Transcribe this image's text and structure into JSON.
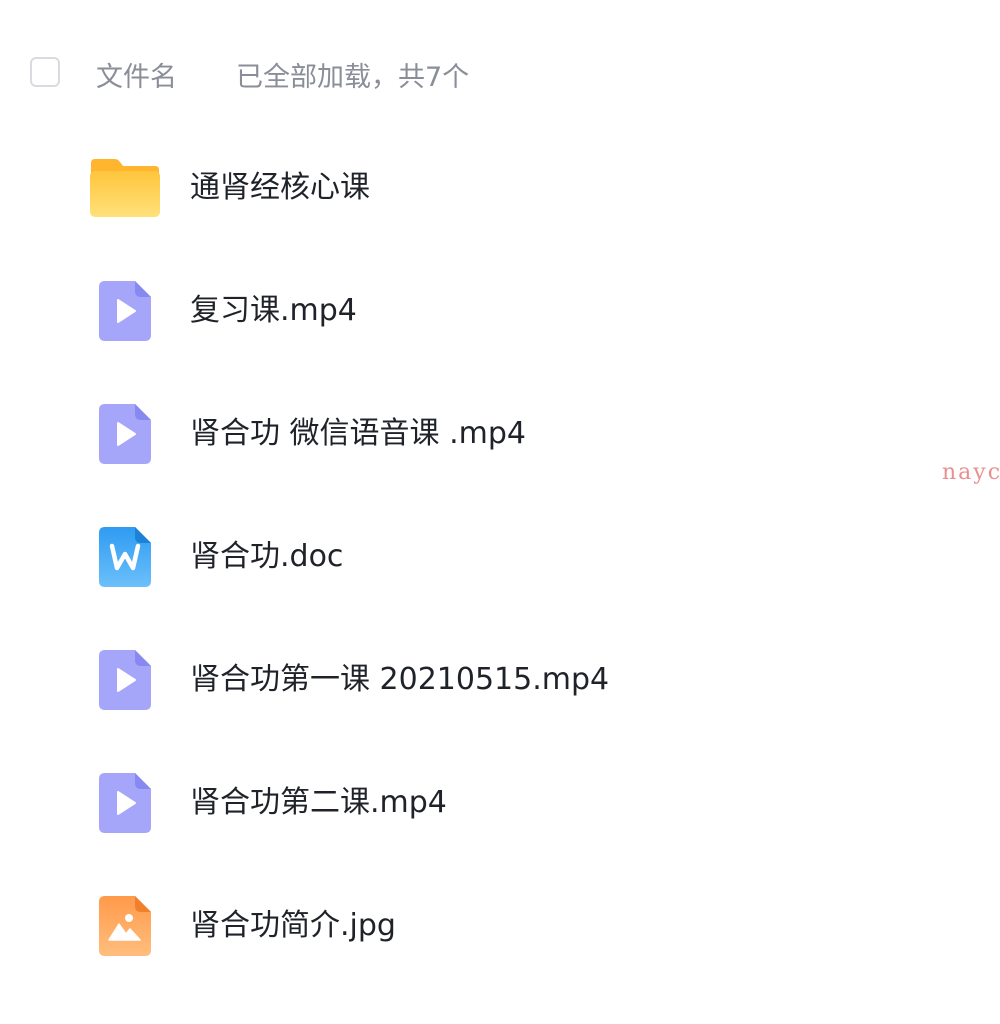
{
  "header": {
    "column_label": "文件名",
    "loaded_status": "已全部加载，共7个"
  },
  "files": [
    {
      "name": "通肾经核心课",
      "type": "folder",
      "icon": "folder-icon",
      "color": "#FFC53D"
    },
    {
      "name": "复习课.mp4",
      "type": "video",
      "icon": "video-file-icon",
      "color": "#9B9CF8"
    },
    {
      "name": "肾合功 微信语音课 .mp4",
      "type": "video",
      "icon": "video-file-icon",
      "color": "#9B9CF8"
    },
    {
      "name": "肾合功.doc",
      "type": "word",
      "icon": "word-file-icon",
      "color": "#3AA3F5"
    },
    {
      "name": "肾合功第一课 20210515.mp4",
      "type": "video",
      "icon": "video-file-icon",
      "color": "#9B9CF8"
    },
    {
      "name": "肾合功第二课.mp4",
      "type": "video",
      "icon": "video-file-icon",
      "color": "#9B9CF8"
    },
    {
      "name": "肾合功简介.jpg",
      "type": "image",
      "icon": "image-file-icon",
      "color": "#FFA55C"
    }
  ],
  "watermark": "nayc"
}
